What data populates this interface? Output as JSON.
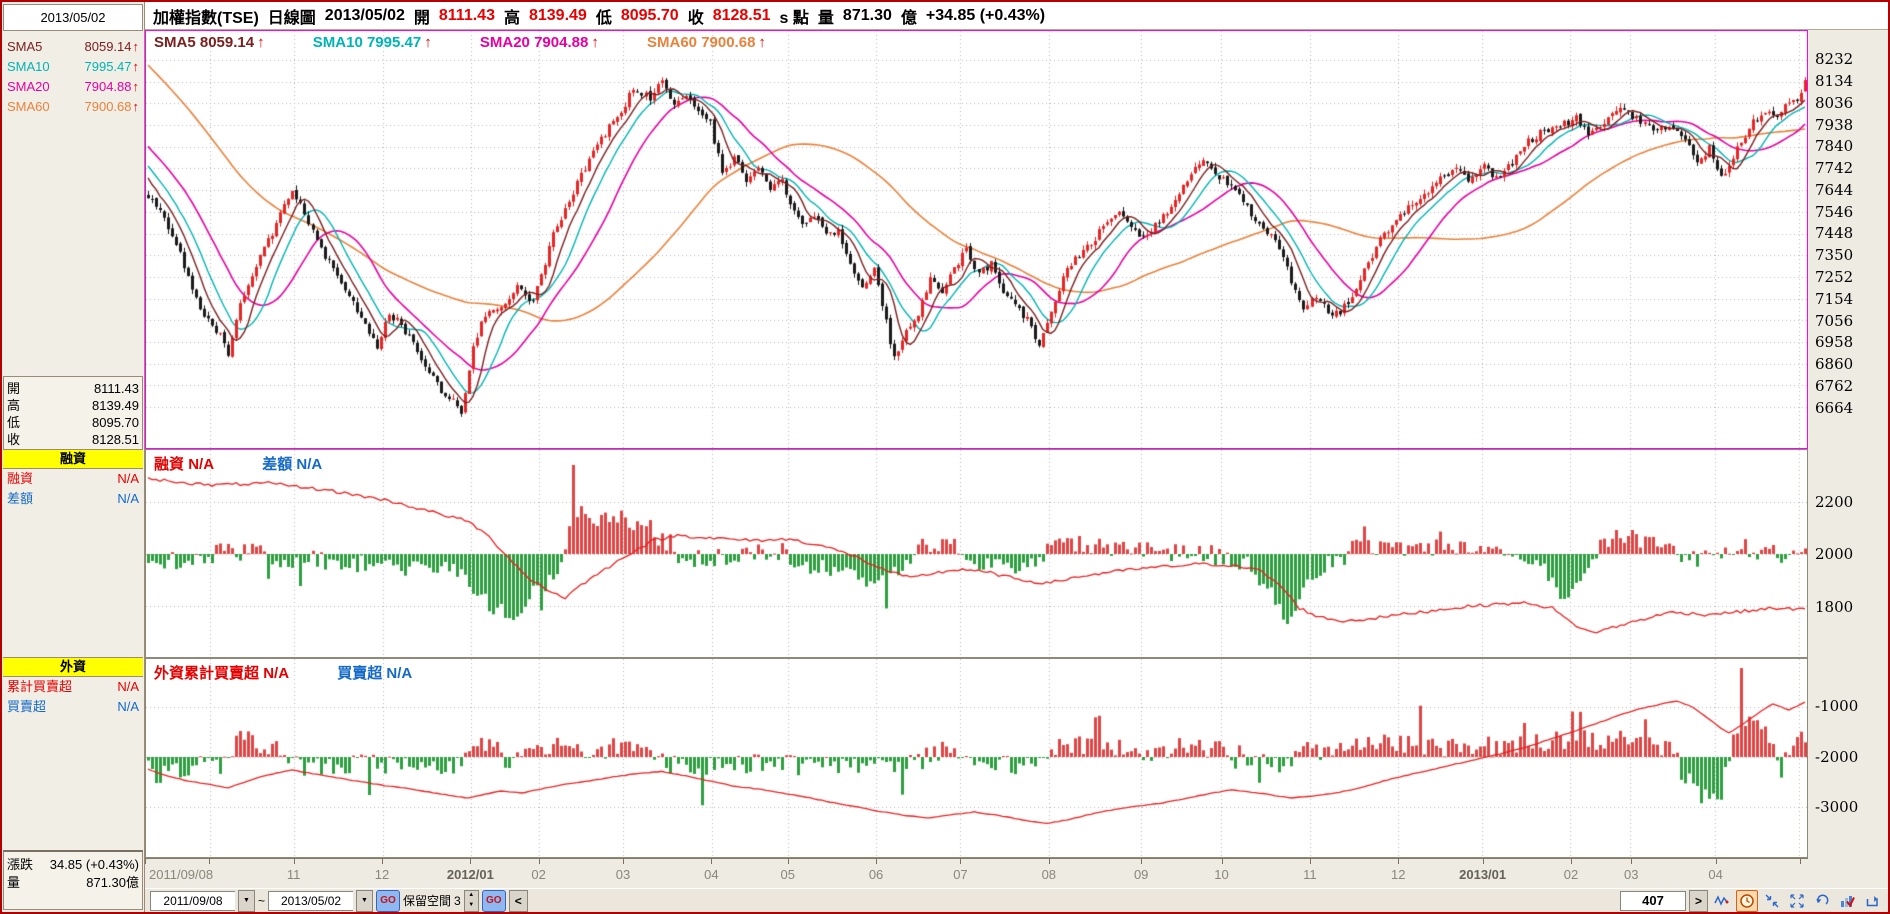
{
  "header": {
    "title": "加權指數(TSE)",
    "mode": "日線圖",
    "date": "2013/05/02",
    "open_label": "開",
    "open": "8111.43",
    "high_label": "高",
    "high": "8139.49",
    "low_label": "低",
    "low": "8095.70",
    "close_label": "收",
    "close": "8128.51",
    "tick_label": "s 點",
    "volume_label": "量",
    "volume": "871.30",
    "volume_unit": "億",
    "change": "+34.85 (+0.43%)"
  },
  "sidebar": {
    "date": "2013/05/02",
    "arrow": "↑",
    "smas": [
      {
        "label": "SMA5",
        "value": "8059.14"
      },
      {
        "label": "SMA10",
        "value": "7995.47"
      },
      {
        "label": "SMA20",
        "value": "7904.88"
      },
      {
        "label": "SMA60",
        "value": "7900.68"
      }
    ],
    "ohlc": [
      {
        "label": "開",
        "value": "8111.43"
      },
      {
        "label": "高",
        "value": "8139.49"
      },
      {
        "label": "低",
        "value": "8095.70"
      },
      {
        "label": "收",
        "value": "8128.51"
      }
    ],
    "margin": {
      "header": "融資",
      "rows": [
        {
          "label": "融資",
          "value": "N/A"
        },
        {
          "label": "差額",
          "value": "N/A"
        }
      ]
    },
    "foreign": {
      "header": "外資",
      "rows": [
        {
          "label": "累計買賣超",
          "value": "N/A"
        },
        {
          "label": "買賣超",
          "value": "N/A"
        }
      ]
    },
    "change": {
      "label": "漲跌",
      "value": "34.85 (+0.43%)"
    },
    "volume": {
      "label": "量",
      "value": "871.30億"
    }
  },
  "legend": {
    "arrow": "↑",
    "main": [
      {
        "label": "SMA5",
        "value": "8059.14"
      },
      {
        "label": "SMA10",
        "value": "7995.47"
      },
      {
        "label": "SMA20",
        "value": "7904.88"
      },
      {
        "label": "SMA60",
        "value": "7900.68"
      }
    ],
    "mid": [
      {
        "label": "融資",
        "value": "N/A"
      },
      {
        "label": "差額",
        "value": "N/A"
      }
    ],
    "bottom": [
      {
        "label": "外資累計買賣超",
        "value": "N/A"
      },
      {
        "label": "買賣超",
        "value": "N/A"
      }
    ]
  },
  "statusbar": {
    "from_date": "2011/09/08",
    "range_separator": "~",
    "to_date": "2013/05/02",
    "go_label": "GO",
    "reserve_label": "保留空間",
    "reserve_value": "3",
    "prev_label": "<",
    "bar_count": "407",
    "next_label": ">"
  },
  "colors": {
    "up": "#e82525",
    "down": "#1a1a1a",
    "sma5": "#7b2020",
    "sma10": "#00b4b4",
    "sma20": "#e600a0",
    "sma60": "#e8823c",
    "panel_line": "#e62020",
    "bar_up": "#e04545",
    "bar_down": "#2e9e40",
    "grid": "#b8b8b8",
    "border_main": "#ff00ff",
    "yellow": "#ffff00",
    "blue": "#1569c7",
    "red": "#e60000"
  },
  "chart_data": {
    "type": "candlestick",
    "title": "加權指數(TSE) 日線圖 2013/05/02",
    "timeline": {
      "total_days": 414,
      "month_ticks": [
        0,
        16,
        37,
        59,
        81,
        98,
        119,
        141,
        160,
        182,
        203,
        225,
        248,
        268,
        290,
        312,
        333,
        355,
        370,
        391,
        412
      ],
      "labels": [
        {
          "day": 0,
          "label": "2011/09/08",
          "bold": false
        },
        {
          "day": 37,
          "label": "11",
          "bold": false
        },
        {
          "day": 59,
          "label": "12",
          "bold": false
        },
        {
          "day": 81,
          "label": "2012/01",
          "bold": true
        },
        {
          "day": 98,
          "label": "02",
          "bold": false
        },
        {
          "day": 119,
          "label": "03",
          "bold": false
        },
        {
          "day": 141,
          "label": "04",
          "bold": false
        },
        {
          "day": 160,
          "label": "05",
          "bold": false
        },
        {
          "day": 182,
          "label": "06",
          "bold": false
        },
        {
          "day": 203,
          "label": "07",
          "bold": false
        },
        {
          "day": 225,
          "label": "08",
          "bold": false
        },
        {
          "day": 248,
          "label": "09",
          "bold": false
        },
        {
          "day": 268,
          "label": "10",
          "bold": false
        },
        {
          "day": 290,
          "label": "11",
          "bold": false
        },
        {
          "day": 312,
          "label": "12",
          "bold": false
        },
        {
          "day": 333,
          "label": "2013/01",
          "bold": true
        },
        {
          "day": 355,
          "label": "02",
          "bold": false
        },
        {
          "day": 370,
          "label": "03",
          "bold": false
        },
        {
          "day": 391,
          "label": "04",
          "bold": false
        }
      ]
    },
    "main": {
      "yticks": [
        8232,
        8134,
        8036,
        7938,
        7840,
        7742,
        7644,
        7546,
        7448,
        7350,
        7252,
        7154,
        7056,
        6958,
        6860,
        6762,
        6664
      ],
      "ylim": [
        6479,
        8363
      ],
      "ohlc": {
        "open": 8111.43,
        "high": 8139.49,
        "low": 8095.7,
        "close": 8128.51
      },
      "smas": {
        "SMA5": 8059.14,
        "SMA10": 7995.47,
        "SMA20": 7904.88,
        "SMA60": 7900.68
      },
      "change": "+34.85 (+0.43%)",
      "volume": "871.30億",
      "price_anchors": [
        [
          0,
          7610
        ],
        [
          4,
          7520
        ],
        [
          8,
          7350
        ],
        [
          12,
          7150
        ],
        [
          15,
          7050
        ],
        [
          18,
          6980
        ],
        [
          20,
          6890
        ],
        [
          23,
          7120
        ],
        [
          27,
          7300
        ],
        [
          31,
          7450
        ],
        [
          36,
          7650
        ],
        [
          39,
          7550
        ],
        [
          43,
          7380
        ],
        [
          48,
          7230
        ],
        [
          53,
          7060
        ],
        [
          57,
          6930
        ],
        [
          60,
          7090
        ],
        [
          64,
          7010
        ],
        [
          68,
          6890
        ],
        [
          72,
          6760
        ],
        [
          76,
          6690
        ],
        [
          78,
          6640
        ],
        [
          81,
          6950
        ],
        [
          84,
          7080
        ],
        [
          88,
          7130
        ],
        [
          92,
          7200
        ],
        [
          96,
          7140
        ],
        [
          98,
          7260
        ],
        [
          101,
          7450
        ],
        [
          105,
          7600
        ],
        [
          109,
          7750
        ],
        [
          113,
          7880
        ],
        [
          117,
          7970
        ],
        [
          121,
          8100
        ],
        [
          125,
          8060
        ],
        [
          128,
          8140
        ],
        [
          131,
          8040
        ],
        [
          134,
          8070
        ],
        [
          137,
          7990
        ],
        [
          140,
          7940
        ],
        [
          143,
          7720
        ],
        [
          146,
          7790
        ],
        [
          149,
          7680
        ],
        [
          152,
          7750
        ],
        [
          155,
          7630
        ],
        [
          158,
          7700
        ],
        [
          160,
          7580
        ],
        [
          163,
          7490
        ],
        [
          166,
          7530
        ],
        [
          169,
          7440
        ],
        [
          172,
          7470
        ],
        [
          175,
          7310
        ],
        [
          178,
          7190
        ],
        [
          181,
          7300
        ],
        [
          183,
          7130
        ],
        [
          186,
          6880
        ],
        [
          189,
          7000
        ],
        [
          192,
          7090
        ],
        [
          195,
          7240
        ],
        [
          198,
          7170
        ],
        [
          201,
          7290
        ],
        [
          204,
          7380
        ],
        [
          207,
          7260
        ],
        [
          210,
          7310
        ],
        [
          213,
          7190
        ],
        [
          216,
          7130
        ],
        [
          219,
          7060
        ],
        [
          222,
          6930
        ],
        [
          225,
          7090
        ],
        [
          228,
          7260
        ],
        [
          231,
          7330
        ],
        [
          234,
          7390
        ],
        [
          238,
          7470
        ],
        [
          242,
          7530
        ],
        [
          245,
          7480
        ],
        [
          248,
          7430
        ],
        [
          251,
          7490
        ],
        [
          255,
          7570
        ],
        [
          259,
          7700
        ],
        [
          263,
          7770
        ],
        [
          266,
          7720
        ],
        [
          269,
          7670
        ],
        [
          273,
          7590
        ],
        [
          277,
          7490
        ],
        [
          281,
          7410
        ],
        [
          284,
          7290
        ],
        [
          288,
          7090
        ],
        [
          291,
          7160
        ],
        [
          295,
          7070
        ],
        [
          299,
          7130
        ],
        [
          303,
          7280
        ],
        [
          307,
          7430
        ],
        [
          311,
          7510
        ],
        [
          314,
          7570
        ],
        [
          318,
          7630
        ],
        [
          322,
          7690
        ],
        [
          326,
          7730
        ],
        [
          330,
          7690
        ],
        [
          333,
          7750
        ],
        [
          336,
          7700
        ],
        [
          340,
          7770
        ],
        [
          344,
          7870
        ],
        [
          348,
          7910
        ],
        [
          352,
          7930
        ],
        [
          356,
          7970
        ],
        [
          359,
          7900
        ],
        [
          363,
          7960
        ],
        [
          367,
          8010
        ],
        [
          371,
          7970
        ],
        [
          375,
          7910
        ],
        [
          379,
          7940
        ],
        [
          383,
          7870
        ],
        [
          386,
          7770
        ],
        [
          389,
          7830
        ],
        [
          392,
          7700
        ],
        [
          395,
          7790
        ],
        [
          399,
          7930
        ],
        [
          403,
          8010
        ],
        [
          406,
          7960
        ],
        [
          409,
          8050
        ],
        [
          411,
          8060
        ],
        [
          412,
          8094
        ],
        [
          413,
          8128
        ]
      ]
    },
    "margin_panel": {
      "yticks": [
        2200,
        2000,
        1800
      ],
      "ylim": [
        1604,
        2400
      ],
      "baseline": 2000,
      "line_anchors": [
        [
          0,
          2290
        ],
        [
          15,
          2265
        ],
        [
          30,
          2272
        ],
        [
          45,
          2245
        ],
        [
          60,
          2205
        ],
        [
          70,
          2165
        ],
        [
          80,
          2125
        ],
        [
          85,
          2065
        ],
        [
          90,
          1985
        ],
        [
          95,
          1905
        ],
        [
          100,
          1858
        ],
        [
          104,
          1832
        ],
        [
          108,
          1882
        ],
        [
          114,
          1942
        ],
        [
          120,
          2002
        ],
        [
          126,
          2052
        ],
        [
          132,
          2072
        ],
        [
          140,
          2062
        ],
        [
          150,
          2052
        ],
        [
          160,
          2057
        ],
        [
          168,
          2032
        ],
        [
          176,
          1992
        ],
        [
          183,
          1942
        ],
        [
          190,
          1907
        ],
        [
          196,
          1927
        ],
        [
          203,
          1942
        ],
        [
          210,
          1927
        ],
        [
          217,
          1902
        ],
        [
          224,
          1887
        ],
        [
          230,
          1907
        ],
        [
          238,
          1927
        ],
        [
          246,
          1942
        ],
        [
          254,
          1952
        ],
        [
          262,
          1962
        ],
        [
          270,
          1957
        ],
        [
          277,
          1937
        ],
        [
          282,
          1882
        ],
        [
          287,
          1792
        ],
        [
          292,
          1757
        ],
        [
          298,
          1742
        ],
        [
          305,
          1752
        ],
        [
          312,
          1767
        ],
        [
          320,
          1782
        ],
        [
          328,
          1797
        ],
        [
          336,
          1807
        ],
        [
          344,
          1812
        ],
        [
          350,
          1792
        ],
        [
          355,
          1732
        ],
        [
          360,
          1697
        ],
        [
          365,
          1717
        ],
        [
          372,
          1747
        ],
        [
          380,
          1777
        ],
        [
          388,
          1767
        ],
        [
          396,
          1777
        ],
        [
          405,
          1792
        ],
        [
          413,
          1787
        ]
      ]
    },
    "foreign_panel": {
      "yticks": [
        -1000,
        -2000,
        -3000
      ],
      "ylim": [
        -4000,
        -40
      ],
      "baseline": -2000,
      "line_anchors": [
        [
          0,
          -2250
        ],
        [
          5,
          -2380
        ],
        [
          10,
          -2480
        ],
        [
          16,
          -2560
        ],
        [
          20,
          -2620
        ],
        [
          24,
          -2500
        ],
        [
          28,
          -2400
        ],
        [
          33,
          -2300
        ],
        [
          36,
          -2260
        ],
        [
          40,
          -2320
        ],
        [
          46,
          -2400
        ],
        [
          52,
          -2480
        ],
        [
          58,
          -2560
        ],
        [
          64,
          -2620
        ],
        [
          70,
          -2700
        ],
        [
          76,
          -2780
        ],
        [
          80,
          -2820
        ],
        [
          84,
          -2740
        ],
        [
          88,
          -2680
        ],
        [
          93,
          -2720
        ],
        [
          98,
          -2640
        ],
        [
          104,
          -2540
        ],
        [
          110,
          -2480
        ],
        [
          116,
          -2400
        ],
        [
          122,
          -2330
        ],
        [
          128,
          -2290
        ],
        [
          134,
          -2380
        ],
        [
          140,
          -2480
        ],
        [
          146,
          -2580
        ],
        [
          152,
          -2640
        ],
        [
          158,
          -2720
        ],
        [
          164,
          -2800
        ],
        [
          170,
          -2900
        ],
        [
          176,
          -2990
        ],
        [
          182,
          -3080
        ],
        [
          188,
          -3160
        ],
        [
          194,
          -3220
        ],
        [
          200,
          -3160
        ],
        [
          206,
          -3100
        ],
        [
          212,
          -3170
        ],
        [
          218,
          -3260
        ],
        [
          224,
          -3330
        ],
        [
          229,
          -3260
        ],
        [
          234,
          -3160
        ],
        [
          240,
          -3060
        ],
        [
          246,
          -2990
        ],
        [
          252,
          -2930
        ],
        [
          258,
          -2840
        ],
        [
          264,
          -2740
        ],
        [
          270,
          -2660
        ],
        [
          275,
          -2700
        ],
        [
          280,
          -2760
        ],
        [
          285,
          -2820
        ],
        [
          290,
          -2780
        ],
        [
          296,
          -2720
        ],
        [
          302,
          -2620
        ],
        [
          308,
          -2480
        ],
        [
          314,
          -2360
        ],
        [
          320,
          -2250
        ],
        [
          326,
          -2140
        ],
        [
          332,
          -2030
        ],
        [
          338,
          -1920
        ],
        [
          344,
          -1790
        ],
        [
          350,
          -1630
        ],
        [
          356,
          -1470
        ],
        [
          362,
          -1300
        ],
        [
          368,
          -1130
        ],
        [
          373,
          -1010
        ],
        [
          378,
          -930
        ],
        [
          381,
          -880
        ],
        [
          385,
          -1000
        ],
        [
          388,
          -1180
        ],
        [
          392,
          -1420
        ],
        [
          394,
          -1520
        ],
        [
          398,
          -1320
        ],
        [
          402,
          -1080
        ],
        [
          405,
          -940
        ],
        [
          409,
          -1060
        ],
        [
          411,
          -980
        ],
        [
          413,
          -900
        ]
      ]
    }
  }
}
